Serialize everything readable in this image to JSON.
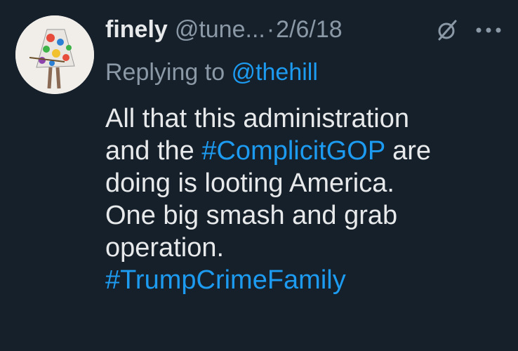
{
  "user": {
    "display_name": "finely",
    "handle": "@tune...",
    "separator": "·",
    "date": "2/6/18"
  },
  "reply": {
    "prefix": "Replying to",
    "mention": "@thehill"
  },
  "body": {
    "line1": "All that this administration",
    "line2_pre": "and the",
    "hashtag1": "#ComplicitGOP",
    "line2_post": "are",
    "line3": "doing is looting America.",
    "line4": "One big smash and grab",
    "line5": "operation.",
    "hashtag2": "#TrumpCrimeFamily"
  },
  "icons": {
    "grok": "grok-icon",
    "more": "more-icon"
  },
  "colors": {
    "background": "#15202b",
    "text": "#e7e9ea",
    "secondary": "#8b98a5",
    "link": "#1d9bf0"
  }
}
